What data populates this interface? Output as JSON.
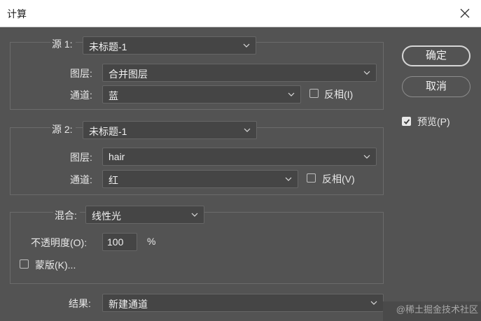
{
  "window": {
    "title": "计算"
  },
  "source1": {
    "label": "源 1:",
    "value": "未标题-1",
    "layer_label": "图层:",
    "layer_value": "合并图层",
    "channel_label": "通道:",
    "channel_value": "蓝",
    "invert_label": "反相(I)",
    "invert_checked": false
  },
  "source2": {
    "label": "源 2:",
    "value": "未标题-1",
    "layer_label": "图层:",
    "layer_value": "hair",
    "channel_label": "通道:",
    "channel_value": "红",
    "invert_label": "反相(V)",
    "invert_checked": false
  },
  "blending": {
    "label": "混合:",
    "value": "线性光",
    "opacity_label": "不透明度(O):",
    "opacity_value": "100",
    "opacity_unit": "%",
    "mask_label": "蒙版(K)...",
    "mask_checked": false
  },
  "result": {
    "label": "结果:",
    "value": "新建通道"
  },
  "buttons": {
    "ok": "确定",
    "cancel": "取消"
  },
  "preview": {
    "label": "预览(P)",
    "checked": true
  },
  "watermark": "@稀土掘金技术社区",
  "icons": {
    "close": "close-icon",
    "dropdown": "chevron-down-icon",
    "check": "checkmark-icon"
  }
}
